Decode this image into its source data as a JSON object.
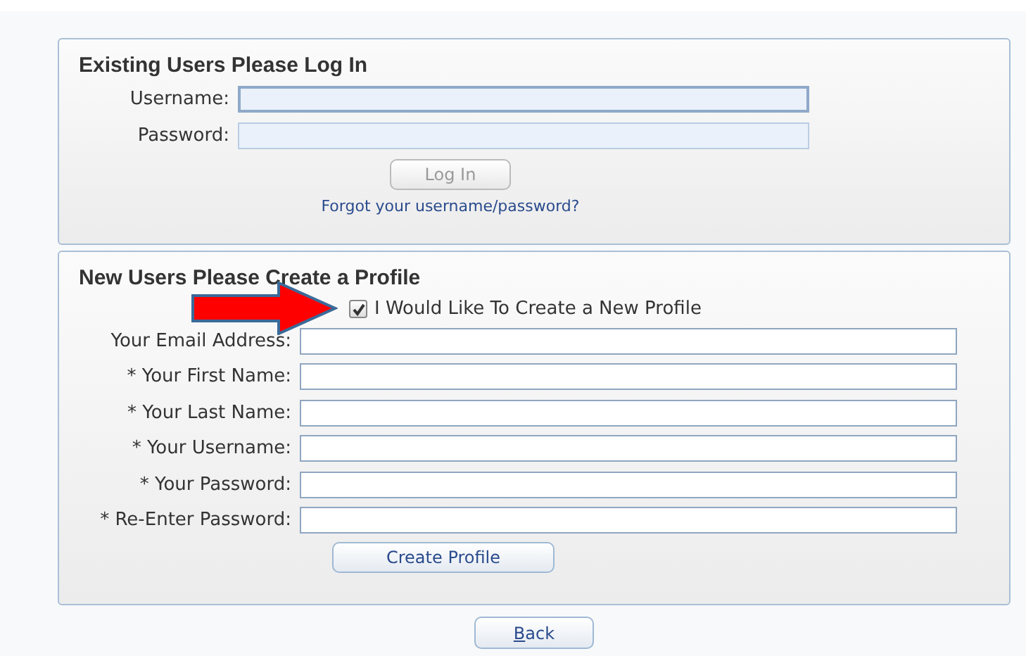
{
  "login": {
    "title": "Existing Users Please Log In",
    "fields": [
      {
        "label": "Username:",
        "focused": true
      },
      {
        "label": "Password:",
        "focused": false
      }
    ],
    "button": {
      "label": "Log In",
      "disabled": true
    },
    "link": "Forgot your username/password?"
  },
  "new_profile": {
    "title": "New Users Please Create a Profile",
    "checkbox": {
      "label": "I Would Like To Create a New Profile",
      "checked": true
    },
    "fields": [
      {
        "label": "Your Email Address:"
      },
      {
        "label": "* Your First Name:"
      },
      {
        "label": "* Your Last Name:"
      },
      {
        "label": "* Your Username:"
      },
      {
        "label": "* Your Password:"
      },
      {
        "label": "* Re-Enter Password:"
      }
    ],
    "button": "Create Profile"
  },
  "back_button": "Back"
}
